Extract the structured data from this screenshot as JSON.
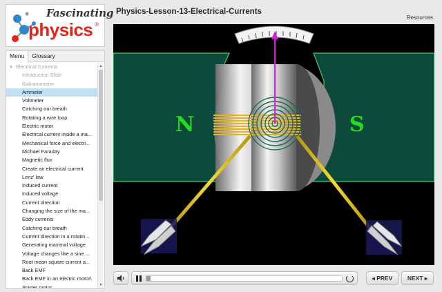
{
  "logo": {
    "line1": "Fascinating",
    "line2": "physics",
    "reg": "®"
  },
  "lesson_title": "Physics-Lesson-13-Electrical-Currents",
  "resources_label": "Resources",
  "tabs": [
    {
      "label": "Menu",
      "active": true
    },
    {
      "label": "Glossary",
      "active": false
    }
  ],
  "menu": {
    "section": "Electrical Currents",
    "items": [
      {
        "label": "Introduction Slide",
        "state": "dim"
      },
      {
        "label": "Galvanometer",
        "state": "dim"
      },
      {
        "label": "Ammeter",
        "state": "selected"
      },
      {
        "label": "Voltmeter",
        "state": "normal"
      },
      {
        "label": "Catching our breath",
        "state": "normal"
      },
      {
        "label": "Rotating a wire loop",
        "state": "normal"
      },
      {
        "label": "Electric motor",
        "state": "normal"
      },
      {
        "label": "Electrical current inside a ma...",
        "state": "normal"
      },
      {
        "label": "Mechanical force and electri...",
        "state": "normal"
      },
      {
        "label": "Michael Faraday",
        "state": "normal"
      },
      {
        "label": "Magnetic flux",
        "state": "normal"
      },
      {
        "label": "Create an electrical current",
        "state": "normal"
      },
      {
        "label": "Lenz' law",
        "state": "normal"
      },
      {
        "label": "Induced current",
        "state": "normal"
      },
      {
        "label": "Induced voltage",
        "state": "normal"
      },
      {
        "label": "Current direction",
        "state": "normal"
      },
      {
        "label": "Changing the size of the ma...",
        "state": "normal"
      },
      {
        "label": "Eddy currents",
        "state": "normal"
      },
      {
        "label": "Catching our breath",
        "state": "normal"
      },
      {
        "label": "Current direction in a rotatin...",
        "state": "normal"
      },
      {
        "label": "Generating maximal voltage",
        "state": "normal"
      },
      {
        "label": "Voltage changes like a sine ...",
        "state": "normal"
      },
      {
        "label": "Root mean square current a...",
        "state": "normal"
      },
      {
        "label": "Back EMF",
        "state": "normal"
      },
      {
        "label": "Back EMF in an electric motor\\",
        "state": "normal"
      },
      {
        "label": "Starter motor",
        "state": "normal"
      }
    ]
  },
  "stage": {
    "pole_left": "N",
    "pole_right": "S",
    "colors": {
      "magnet": "#0d4a3c",
      "magnet_outline": "#3fcf6e",
      "pole_text": "#22dd22",
      "coil": "#e6b31a",
      "needle": "#d51fd5",
      "lead": "#e8c51d",
      "clip": "#1a1a5a"
    }
  },
  "controls": {
    "volume_icon": "speaker-icon",
    "pause_icon": "pause-icon",
    "replay_icon": "replay-icon",
    "progress": 0.02,
    "prev_label": "◂ PREV",
    "next_label": "NEXT ▸"
  }
}
